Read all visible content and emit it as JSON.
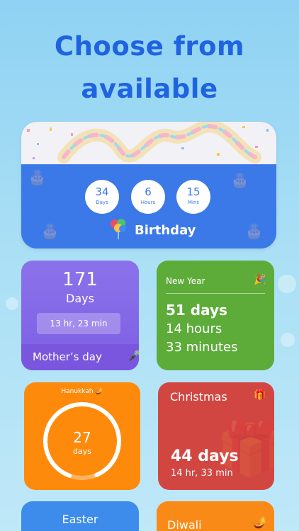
{
  "headline": {
    "line1": "Choose from",
    "line2": "available"
  },
  "birthday": {
    "title": "Birthday",
    "counters": [
      {
        "value": "34",
        "unit": "Days"
      },
      {
        "value": "6",
        "unit": "Hours"
      },
      {
        "value": "15",
        "unit": "Mins"
      }
    ],
    "icon": "balloons-icon",
    "accent": "#3b78e7"
  },
  "mothers_day": {
    "number": "171",
    "label": "Days",
    "detail": "13 hr, 23 min",
    "title": "Mother’s day",
    "icon": "microphone-icon",
    "color": "#8067e6"
  },
  "new_year": {
    "title": "New Year",
    "line1": "51 days",
    "line2": "14 hours",
    "line3": "33 minutes",
    "icon": "party-popper-icon",
    "color": "#5dac3a"
  },
  "hanukkah": {
    "title": "Hanukkah",
    "number": "27",
    "unit": "days",
    "progress": 0.88,
    "icon": "oil-lamp-icon",
    "color": "#fe8a0c"
  },
  "christmas": {
    "title": "Christmas",
    "days": "44 days",
    "detail": "14 hr, 33 min",
    "icon": "gift-icon",
    "color": "#d24642"
  },
  "easter": {
    "title": "Easter",
    "color": "#3d8bea"
  },
  "diwali": {
    "title": "Diwali",
    "icon": "diya-icon",
    "color": "#fa8a17"
  }
}
